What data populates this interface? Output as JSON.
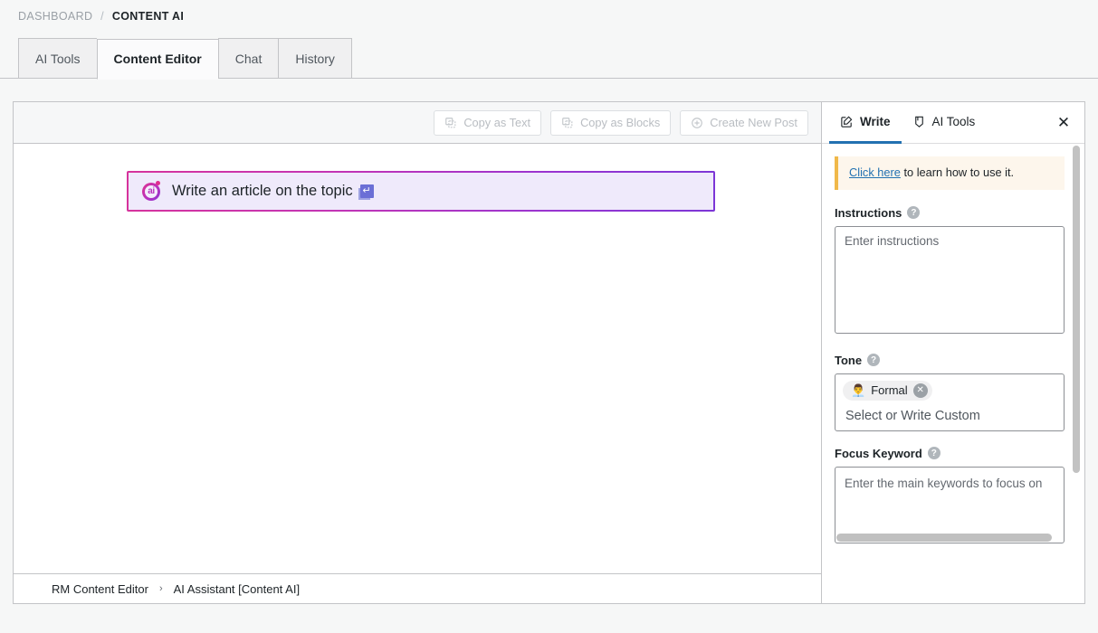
{
  "breadcrumb": {
    "root": "DASHBOARD",
    "separator": "/",
    "current": "CONTENT AI"
  },
  "tabs": [
    {
      "label": "AI Tools",
      "active": false
    },
    {
      "label": "Content Editor",
      "active": true
    },
    {
      "label": "Chat",
      "active": false
    },
    {
      "label": "History",
      "active": false
    }
  ],
  "editor": {
    "toolbar": {
      "copy_as_text": "Copy as Text",
      "copy_as_blocks": "Copy as Blocks",
      "create_new_post": "Create New Post",
      "copy_icon": "copy-icon",
      "plus_icon": "plus-circle-icon"
    },
    "block": {
      "logo": "content-ai-logo",
      "text": "Write an article on the topic",
      "enter_key_icon": "enter-key-icon"
    },
    "status": {
      "left": "RM Content Editor",
      "chevron": "›",
      "right": "AI Assistant [Content AI]"
    }
  },
  "sidebar": {
    "tabs": [
      {
        "label": "Write",
        "icon": "pencil-square-icon",
        "active": true
      },
      {
        "label": "AI Tools",
        "icon": "tools-icon",
        "active": false
      }
    ],
    "close_icon": "✕",
    "notice": {
      "link": "Click here",
      "text": " to learn how to use it."
    },
    "fields": {
      "instructions": {
        "label": "Instructions",
        "help_icon": "?",
        "value": "",
        "placeholder": "Enter instructions"
      },
      "tone": {
        "label": "Tone",
        "help_icon": "?",
        "chips": [
          {
            "emoji": "👨‍💼",
            "label": "Formal",
            "remove_icon": "✕"
          }
        ],
        "input_placeholder": "Select or Write Custom"
      },
      "focus_keyword": {
        "label": "Focus Keyword",
        "help_icon": "?",
        "value": "",
        "placeholder": "Enter the main keywords to focus on"
      }
    }
  },
  "colors": {
    "accent_blue": "#2271b1",
    "notice_border": "#f0b849",
    "block_gradient_start": "#d6339c",
    "block_gradient_end": "#7c36d6"
  }
}
